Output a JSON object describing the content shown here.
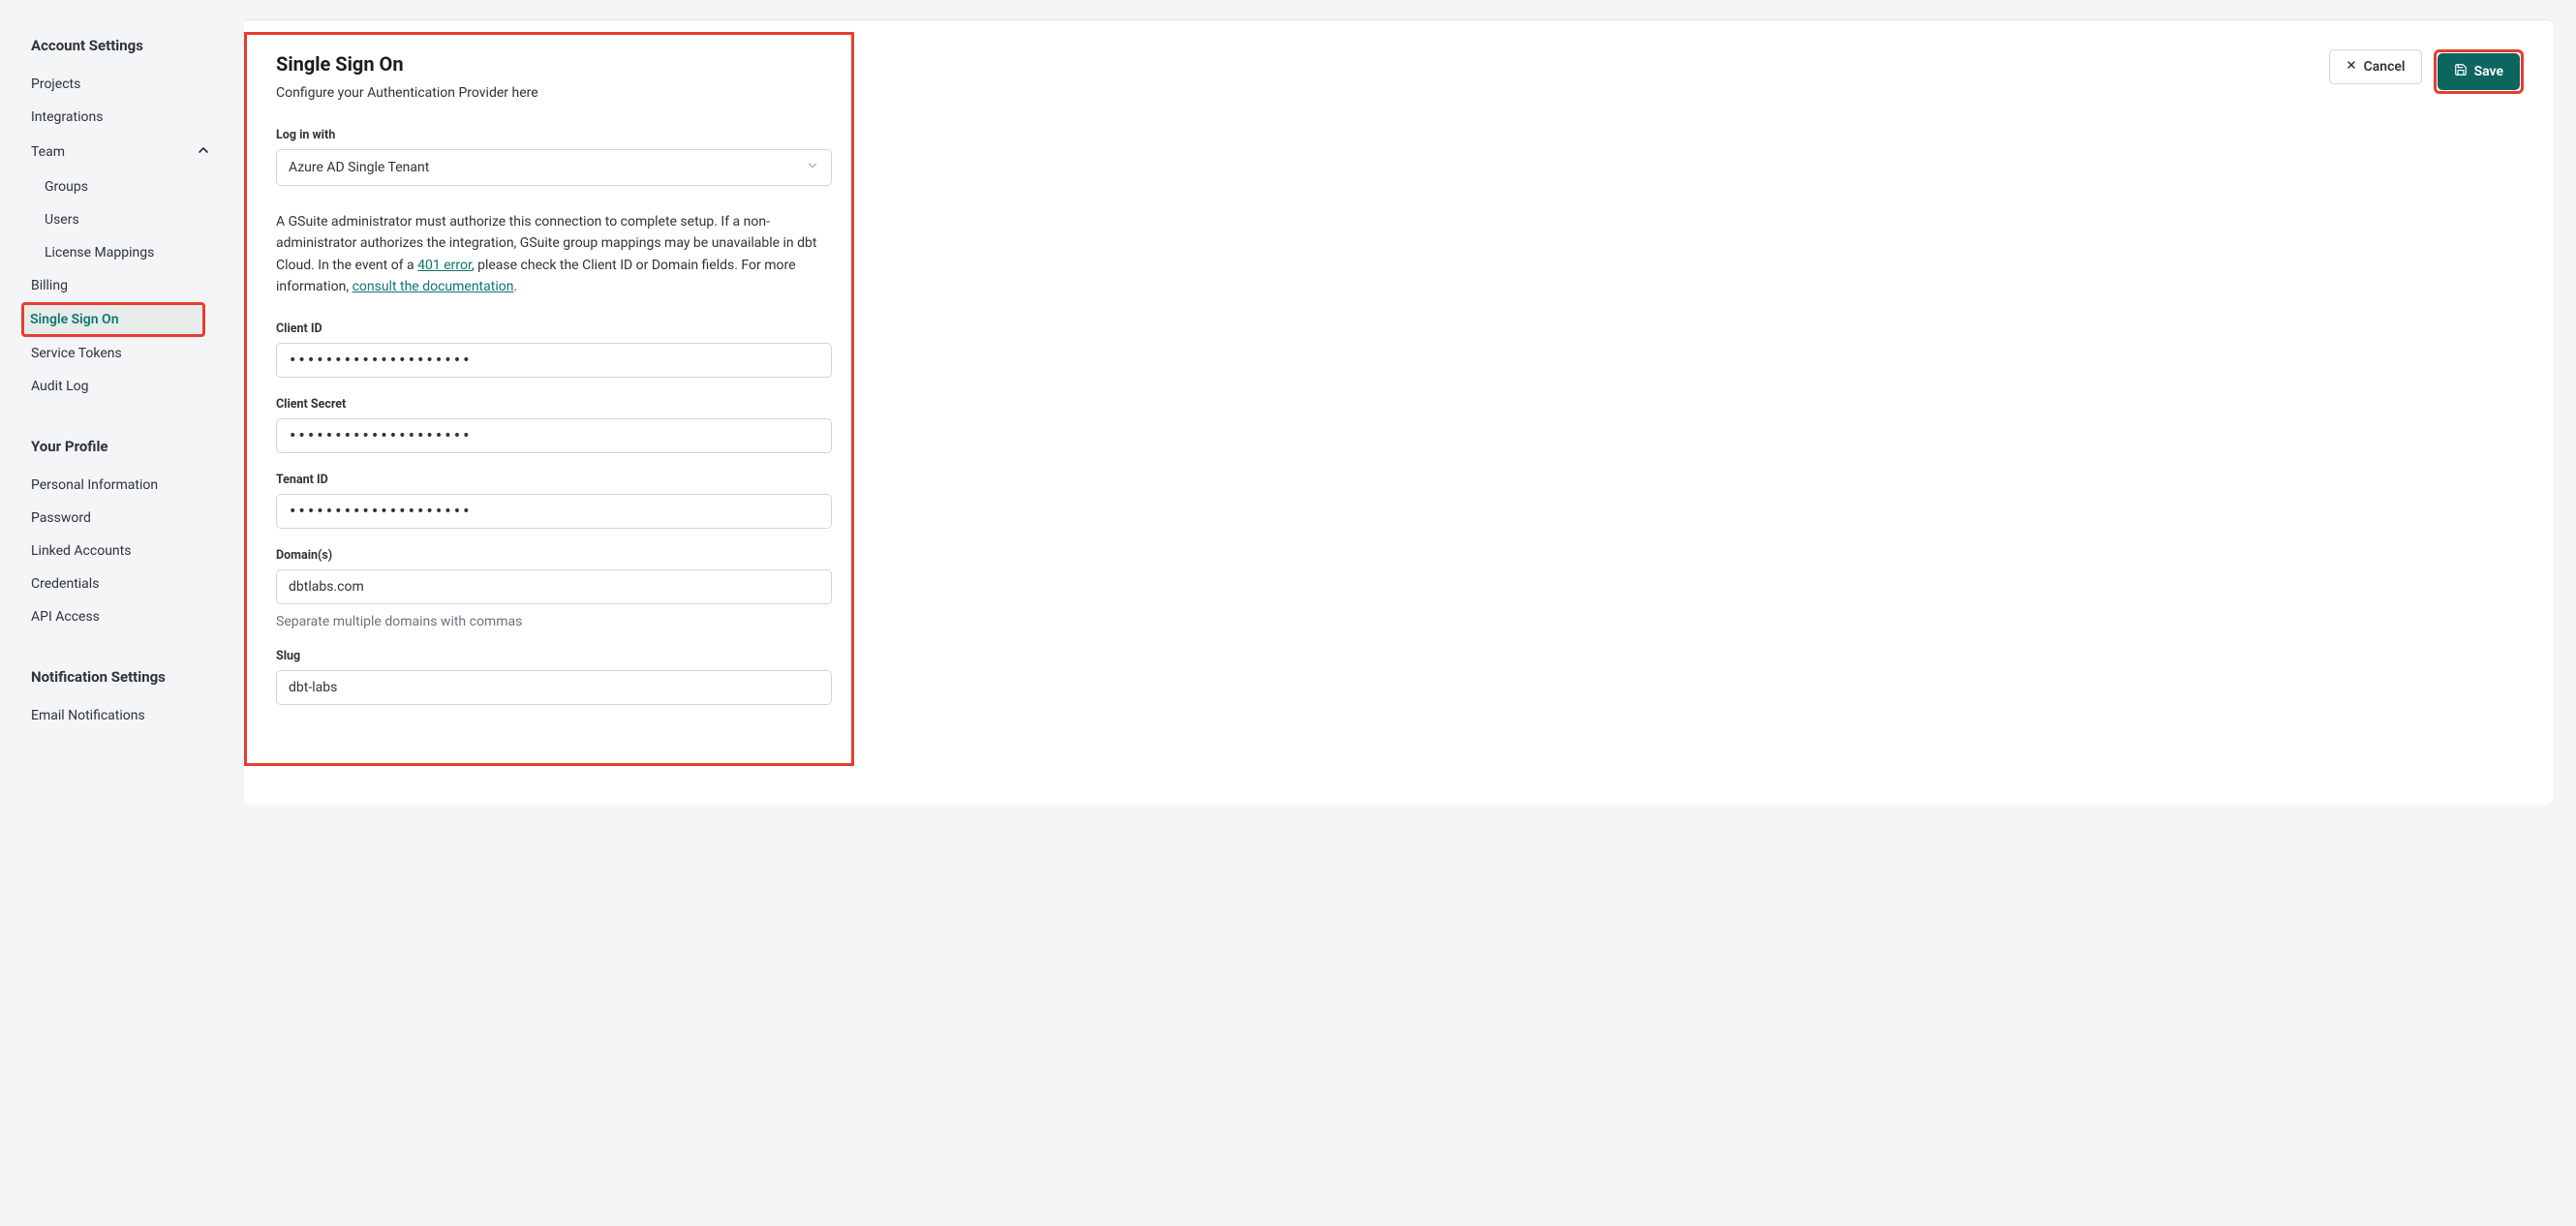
{
  "sidebar": {
    "section1_header": "Account Settings",
    "projects": "Projects",
    "integrations": "Integrations",
    "team": "Team",
    "groups": "Groups",
    "users": "Users",
    "license_mappings": "License Mappings",
    "billing": "Billing",
    "sso": "Single Sign On",
    "service_tokens": "Service Tokens",
    "audit_log": "Audit Log",
    "section2_header": "Your Profile",
    "personal_info": "Personal Information",
    "password": "Password",
    "linked_accounts": "Linked Accounts",
    "credentials": "Credentials",
    "api_access": "API Access",
    "section3_header": "Notification Settings",
    "email_notifications": "Email Notifications"
  },
  "form": {
    "title": "Single Sign On",
    "subtitle": "Configure your Authentication Provider here",
    "login_with_label": "Log in with",
    "login_with_value": "Azure AD Single Tenant",
    "info_prefix": "A GSuite administrator must authorize this connection to complete setup. If a non-administrator authorizes the integration, GSuite group mappings may be unavailable in dbt Cloud. In the event of a ",
    "info_link1": "401 error",
    "info_mid": ", please check the Client ID or Domain fields. For more information, ",
    "info_link2": "consult the documentation",
    "info_suffix": ".",
    "client_id_label": "Client ID",
    "client_id_value": "••••••••••••••••••••",
    "client_secret_label": "Client Secret",
    "client_secret_value": "••••••••••••••••••••",
    "tenant_id_label": "Tenant ID",
    "tenant_id_value": "••••••••••••••••••••",
    "domains_label": "Domain(s)",
    "domains_value": "dbtlabs.com",
    "domains_helper": "Separate multiple domains with commas",
    "slug_label": "Slug",
    "slug_value": "dbt-labs"
  },
  "actions": {
    "cancel": "Cancel",
    "save": "Save"
  }
}
